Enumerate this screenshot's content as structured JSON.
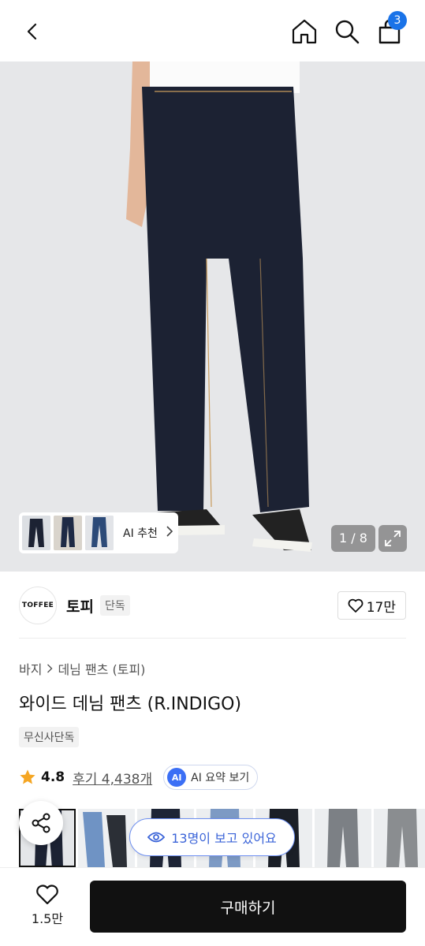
{
  "header": {
    "cart_count": "3"
  },
  "gallery": {
    "ai_recommend_label": "AI 추천",
    "counter": "1 / 8"
  },
  "brand": {
    "logo_text": "TOFFEE",
    "name": "토피",
    "tag": "단독",
    "likes": "17만"
  },
  "product": {
    "breadcrumb": [
      "바지",
      "데님 팬츠 (토피)"
    ],
    "title": "와이드 데님 팬츠 (R.INDIGO)",
    "tag": "무신사단독",
    "rating": "4.8",
    "review_label": "후기 4,438개",
    "ai_badge": "AI",
    "ai_summary_label": "AI 요약 보기"
  },
  "viewers": {
    "label": "13명이 보고 있어요"
  },
  "bottom_bar": {
    "wish_count": "1.5만",
    "buy_label": "구매하기"
  },
  "colors": {
    "accent_blue": "#1a73e8",
    "ai_blue": "#3b6ff5",
    "buy_button": "#111111",
    "star": "#f5a623",
    "denim": "#1c2233"
  },
  "icons": [
    "back-icon",
    "home-icon",
    "search-icon",
    "cart-icon",
    "chevron-right-icon",
    "expand-icon",
    "heart-icon",
    "star-icon",
    "share-icon",
    "eye-icon"
  ]
}
